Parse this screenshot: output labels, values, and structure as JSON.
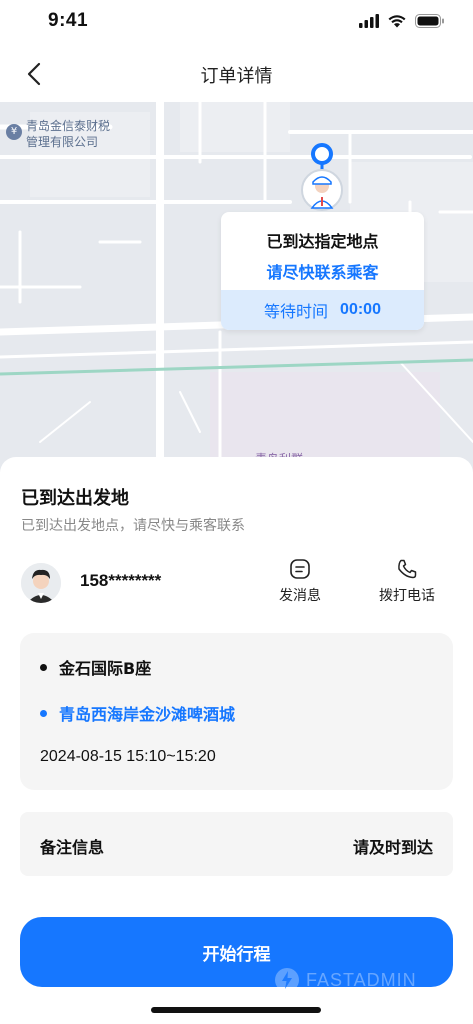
{
  "status_bar": {
    "time": "9:41"
  },
  "nav": {
    "title": "订单详情"
  },
  "map": {
    "poi_line1": "青岛金信泰财税",
    "poi_line2": "管理有限公司",
    "bottom_label": "青岛利群"
  },
  "info_card": {
    "title": "已到达指定地点",
    "subtitle": "请尽快联系乘客",
    "wait_label": "等待时间",
    "wait_time": "00:00"
  },
  "sheet": {
    "title": "已到达出发地",
    "subtitle": "已到达出发地点，请尽快与乘客联系"
  },
  "contact": {
    "phone": "158********",
    "message_label": "发消息",
    "call_label": "拨打电话"
  },
  "route": {
    "origin": "金石国际B座",
    "destination": "青岛西海岸金沙滩啤酒城",
    "time": "2024-08-15 15:10~15:20"
  },
  "remark": {
    "label": "备注信息",
    "value": "请及时到达"
  },
  "start_button": {
    "label": "开始行程"
  },
  "watermark": {
    "text": "FASTADMIN"
  },
  "colors": {
    "accent": "#1677ff",
    "wait_bg": "#dcebfd",
    "card_bg": "#f5f5f5",
    "map_bg": "#e6e9ee"
  }
}
